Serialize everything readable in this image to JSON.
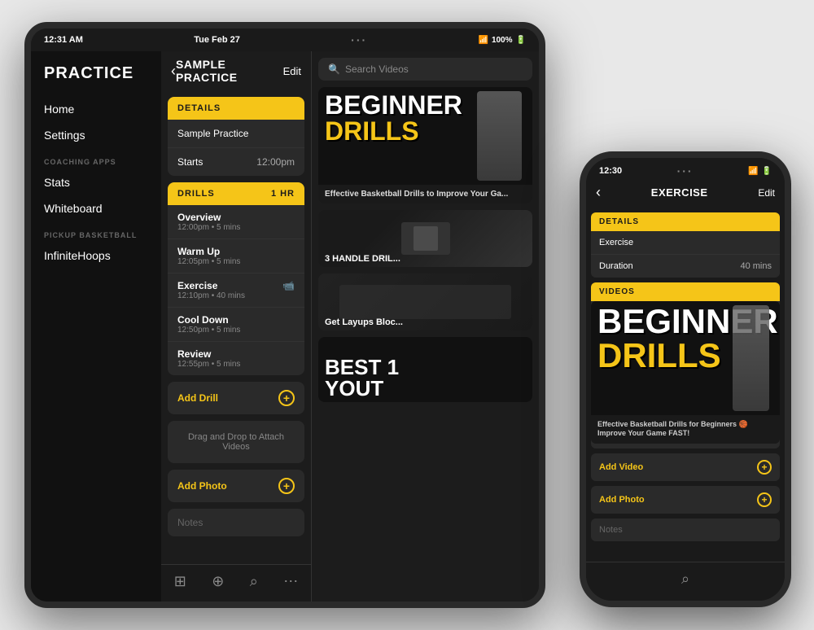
{
  "tablet": {
    "status_bar": {
      "time": "12:31 AM",
      "date": "Tue Feb 27",
      "battery": "100%",
      "signal": "WiFi"
    },
    "sidebar": {
      "title": "PRACTICE",
      "nav_items": [
        {
          "label": "Home"
        },
        {
          "label": "Settings"
        }
      ],
      "section_coaching": "COACHING APPS",
      "coaching_items": [
        {
          "label": "Stats"
        },
        {
          "label": "Whiteboard"
        }
      ],
      "section_pickup": "PICKUP BASKETBALL",
      "pickup_items": [
        {
          "label": "InfiniteHoops"
        }
      ]
    },
    "main": {
      "back_label": "‹",
      "title": "SAMPLE PRACTICE",
      "edit_label": "Edit",
      "details_section": {
        "header": "DETAILS",
        "rows": [
          {
            "label": "Sample Practice",
            "value": ""
          },
          {
            "label": "Starts",
            "value": "12:00pm"
          }
        ]
      },
      "drills_section": {
        "header": "DRILLS",
        "duration": "1 HR",
        "items": [
          {
            "name": "Overview",
            "time": "12:00pm • 5 mins",
            "icon": ""
          },
          {
            "name": "Warm Up",
            "time": "12:05pm • 5 mins",
            "icon": ""
          },
          {
            "name": "Exercise",
            "time": "12:10pm • 40 mins",
            "icon": "📹"
          },
          {
            "name": "Cool Down",
            "time": "12:50pm • 5 mins",
            "icon": ""
          },
          {
            "name": "Review",
            "time": "12:55pm • 5 mins",
            "icon": ""
          }
        ]
      },
      "add_drill_label": "Add Drill",
      "drag_drop_label": "Drag and Drop to Attach Videos",
      "add_photo_label": "Add Photo",
      "notes_label": "Notes"
    },
    "bottom_bar": {
      "icons": [
        "⊞",
        "⊕",
        "⌕",
        "⋯"
      ]
    }
  },
  "right_panel": {
    "search": {
      "placeholder": "Search Videos"
    },
    "videos": [
      {
        "title_line1": "BEGINNER",
        "title_line2": "DRILLS",
        "caption": "Effective Basketball Drills to Improve Your Ga..."
      },
      {
        "title": "3 HANDLE DRIL...",
        "caption": ""
      },
      {
        "title": "Get Layups Bloc...",
        "caption": ""
      },
      {
        "title_line1": "BEST 1",
        "title_line2": "YOUT",
        "caption": ""
      }
    ]
  },
  "phone": {
    "status_bar": {
      "time": "12:30",
      "icons": "WiFi Bat"
    },
    "header": {
      "back_label": "‹",
      "title": "EXERCISE",
      "edit_label": "Edit"
    },
    "details_section": {
      "header": "DETAILS",
      "rows": [
        {
          "label": "Exercise",
          "value": ""
        },
        {
          "label": "Duration",
          "value": "40 mins"
        }
      ]
    },
    "videos_section": {
      "header": "VIDEOS",
      "video": {
        "title_line1": "BEGINNER",
        "title_line2": "DRILLS",
        "caption": "Effective Basketball Drills for Beginners 🏀 Improve Your Game FAST!"
      }
    },
    "add_video_label": "Add Video",
    "add_photo_label": "Add Photo",
    "notes_label": "Notes",
    "bottom_search": "⌕"
  }
}
